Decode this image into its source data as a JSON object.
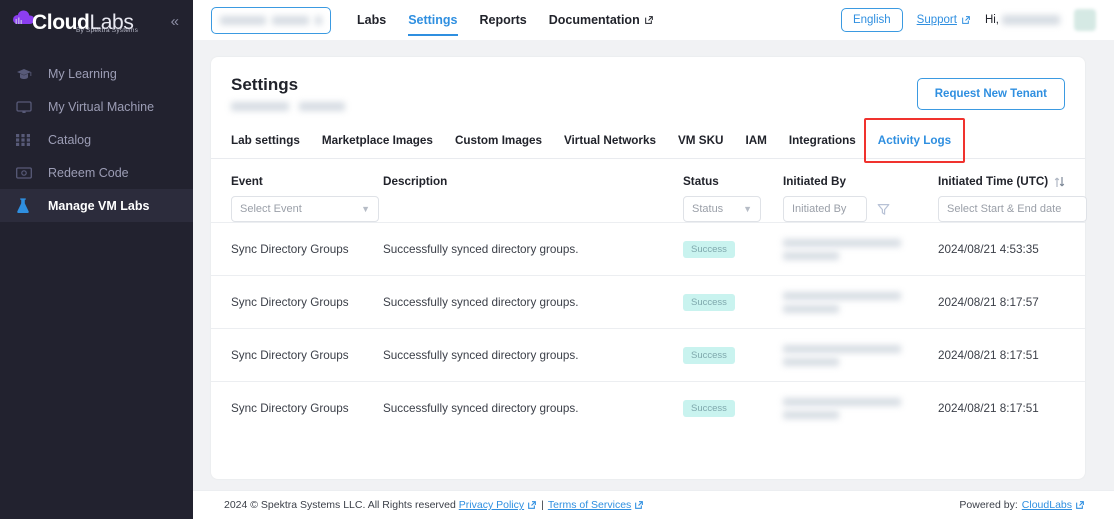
{
  "brand": {
    "name_bold": "Cloud",
    "name_light": "Labs",
    "tagline": "By Spektra Systems",
    "collapse_icon": "chevron-double-left-icon"
  },
  "sidebar": {
    "items": [
      {
        "label": "My Learning",
        "icon": "graduation-cap-icon",
        "active": false
      },
      {
        "label": "My Virtual Machine",
        "icon": "monitor-icon",
        "active": false
      },
      {
        "label": "Catalog",
        "icon": "grid-icon",
        "active": false
      },
      {
        "label": "Redeem Code",
        "icon": "banknote-icon",
        "active": false
      },
      {
        "label": "Manage VM Labs",
        "icon": "flask-icon",
        "active": true
      }
    ]
  },
  "topbar": {
    "tenant_selector_redacted": true,
    "nav": [
      {
        "label": "Labs",
        "active": false,
        "external": false
      },
      {
        "label": "Settings",
        "active": true,
        "external": false
      },
      {
        "label": "Reports",
        "active": false,
        "external": false
      },
      {
        "label": "Documentation",
        "active": false,
        "external": true
      }
    ],
    "language_label": "English",
    "support_label": "Support",
    "greeting_prefix": "Hi,",
    "user_name_redacted": true
  },
  "page": {
    "title": "Settings",
    "subtitle_redacted": true,
    "request_button": "Request New Tenant"
  },
  "tabs": [
    {
      "label": "Lab settings",
      "active": false
    },
    {
      "label": "Marketplace Images",
      "active": false
    },
    {
      "label": "Custom Images",
      "active": false
    },
    {
      "label": "Virtual Networks",
      "active": false
    },
    {
      "label": "VM SKU",
      "active": false
    },
    {
      "label": "IAM",
      "active": false
    },
    {
      "label": "Integrations",
      "active": false
    },
    {
      "label": "Activity Logs",
      "active": true,
      "highlighted": true
    }
  ],
  "table": {
    "columns": [
      {
        "key": "event",
        "label": "Event"
      },
      {
        "key": "description",
        "label": "Description"
      },
      {
        "key": "status",
        "label": "Status"
      },
      {
        "key": "initiated_by",
        "label": "Initiated By"
      },
      {
        "key": "initiated_time",
        "label": "Initiated Time (UTC)",
        "sort_icon": "sort-arrows-icon"
      }
    ],
    "filters": {
      "event_placeholder": "Select Event",
      "status_placeholder": "Status",
      "initiated_by_placeholder": "Initiated By",
      "date_placeholder": "Select Start & End date",
      "filter_icon": "funnel-filter-icon"
    },
    "rows": [
      {
        "event": "Sync Directory Groups",
        "description": "Successfully synced directory groups.",
        "status": "Success",
        "initiated_by_redacted": true,
        "initiated_time": "2024/08/21 4:53:35"
      },
      {
        "event": "Sync Directory Groups",
        "description": "Successfully synced directory groups.",
        "status": "Success",
        "initiated_by_redacted": true,
        "initiated_time": "2024/08/21 8:17:57"
      },
      {
        "event": "Sync Directory Groups",
        "description": "Successfully synced directory groups.",
        "status": "Success",
        "initiated_by_redacted": true,
        "initiated_time": "2024/08/21 8:17:51"
      },
      {
        "event": "Sync Directory Groups",
        "description": "Successfully synced directory groups.",
        "status": "Success",
        "initiated_by_redacted": true,
        "initiated_time": "2024/08/21 8:17:51"
      }
    ]
  },
  "footer": {
    "copyright": "2024 © Spektra Systems LLC. All Rights reserved",
    "privacy_label": "Privacy Policy",
    "separator": "|",
    "terms_label": "Terms of Services",
    "powered_prefix": "Powered by:",
    "powered_link": "CloudLabs"
  },
  "colors": {
    "accent_blue": "#2f8fe0",
    "sidebar_bg": "#22222f",
    "page_bg": "#f1f2f4",
    "badge_bg": "#c9f3ef",
    "badge_text": "#7fa8ad",
    "annotation_red": "#f0322e"
  }
}
